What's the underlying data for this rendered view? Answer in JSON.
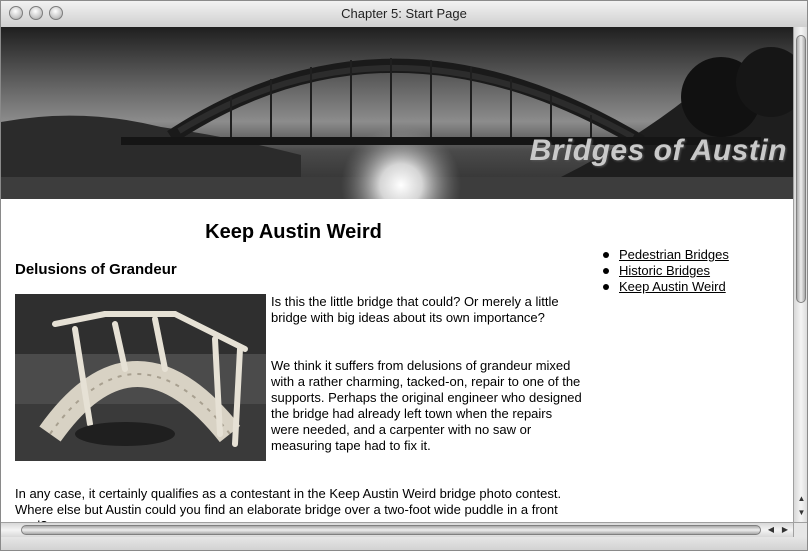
{
  "window": {
    "title": "Chapter 5: Start Page"
  },
  "banner": {
    "title": "Bridges of Austin"
  },
  "page": {
    "heading": "Keep Austin Weird",
    "section_heading": "Delusions of Grandeur",
    "paragraphs": [
      "Is this the little bridge that could? Or merely a little bridge with big ideas about its own importance?",
      "We think it suffers from delusions of grandeur mixed with a rather charming, tacked-on, repair to one of the supports. Perhaps the original engineer who designed the bridge had already left town when the repairs were needed, and a carpenter with no saw or measuring tape had to fix it.",
      "In any case, it certainly qualifies as a contestant in the Keep Austin Weird bridge photo contest. Where else but Austin could you find an elaborate bridge over a two-foot wide puddle in a front yard?"
    ]
  },
  "nav": {
    "links": [
      {
        "label": "Pedestrian Bridges"
      },
      {
        "label": "Historic Bridges"
      },
      {
        "label": "Keep Austin Weird"
      }
    ]
  },
  "scrollbar": {
    "vertical_position": 0.02,
    "horizontal_position": 0.0
  },
  "colors": {
    "text": "#000000",
    "banner_title": "#c9c9c9",
    "background": "#ffffff"
  }
}
